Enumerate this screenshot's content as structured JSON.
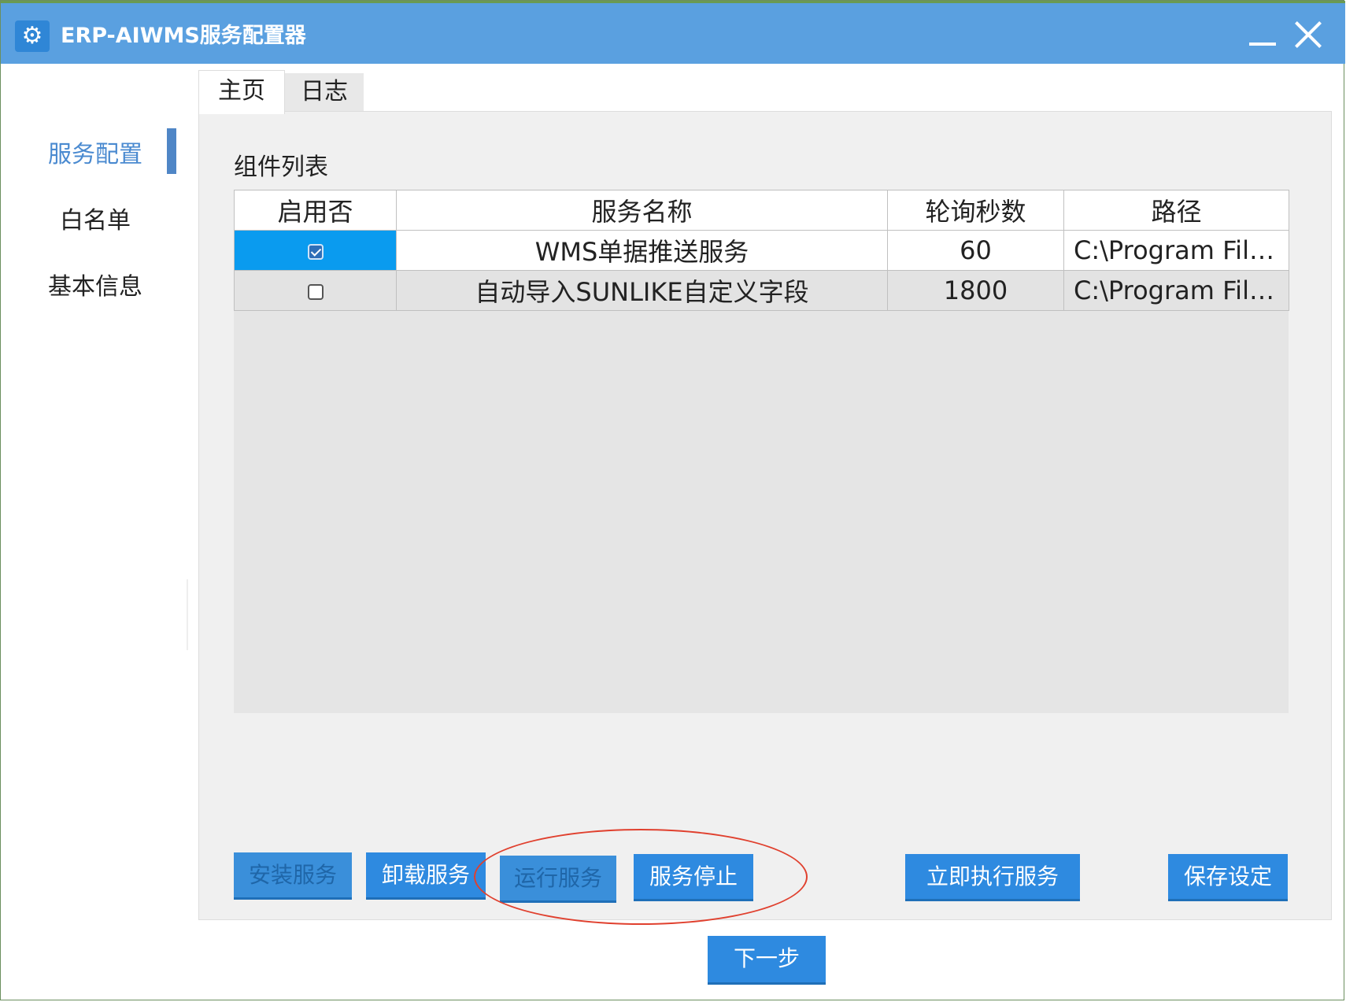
{
  "window": {
    "title": "ERP-AIWMS服务配置器",
    "app_icon": "gear-icon",
    "titlebar_color": "#5aa0e0"
  },
  "sidebar": {
    "items": [
      {
        "label": "服务配置",
        "active": true
      },
      {
        "label": "白名单",
        "active": false
      },
      {
        "label": "基本信息",
        "active": false
      }
    ],
    "active_color": "#4a8ad0"
  },
  "tabs": [
    {
      "label": "主页",
      "selected": true
    },
    {
      "label": "日志",
      "selected": false
    }
  ],
  "main": {
    "section_title": "组件列表",
    "columns": [
      "启用否",
      "服务名称",
      "轮询秒数",
      "路径"
    ],
    "rows": [
      {
        "enabled": true,
        "name": "WMS单据推送服务",
        "interval": "60",
        "path": "C:\\Program File..."
      },
      {
        "enabled": false,
        "name": "自动导入SUNLIKE自定义字段",
        "interval": "1800",
        "path": "C:\\Program File..."
      }
    ]
  },
  "buttons": {
    "install": "安装服务",
    "uninstall": "卸载服务",
    "run": "运行服务",
    "stop": "服务停止",
    "execute_now": "立即执行服务",
    "save": "保存设定",
    "next": "下一步"
  },
  "colors": {
    "button": "#2e8ae0",
    "selection": "#0a9bef",
    "annotation": "#e0402e"
  }
}
